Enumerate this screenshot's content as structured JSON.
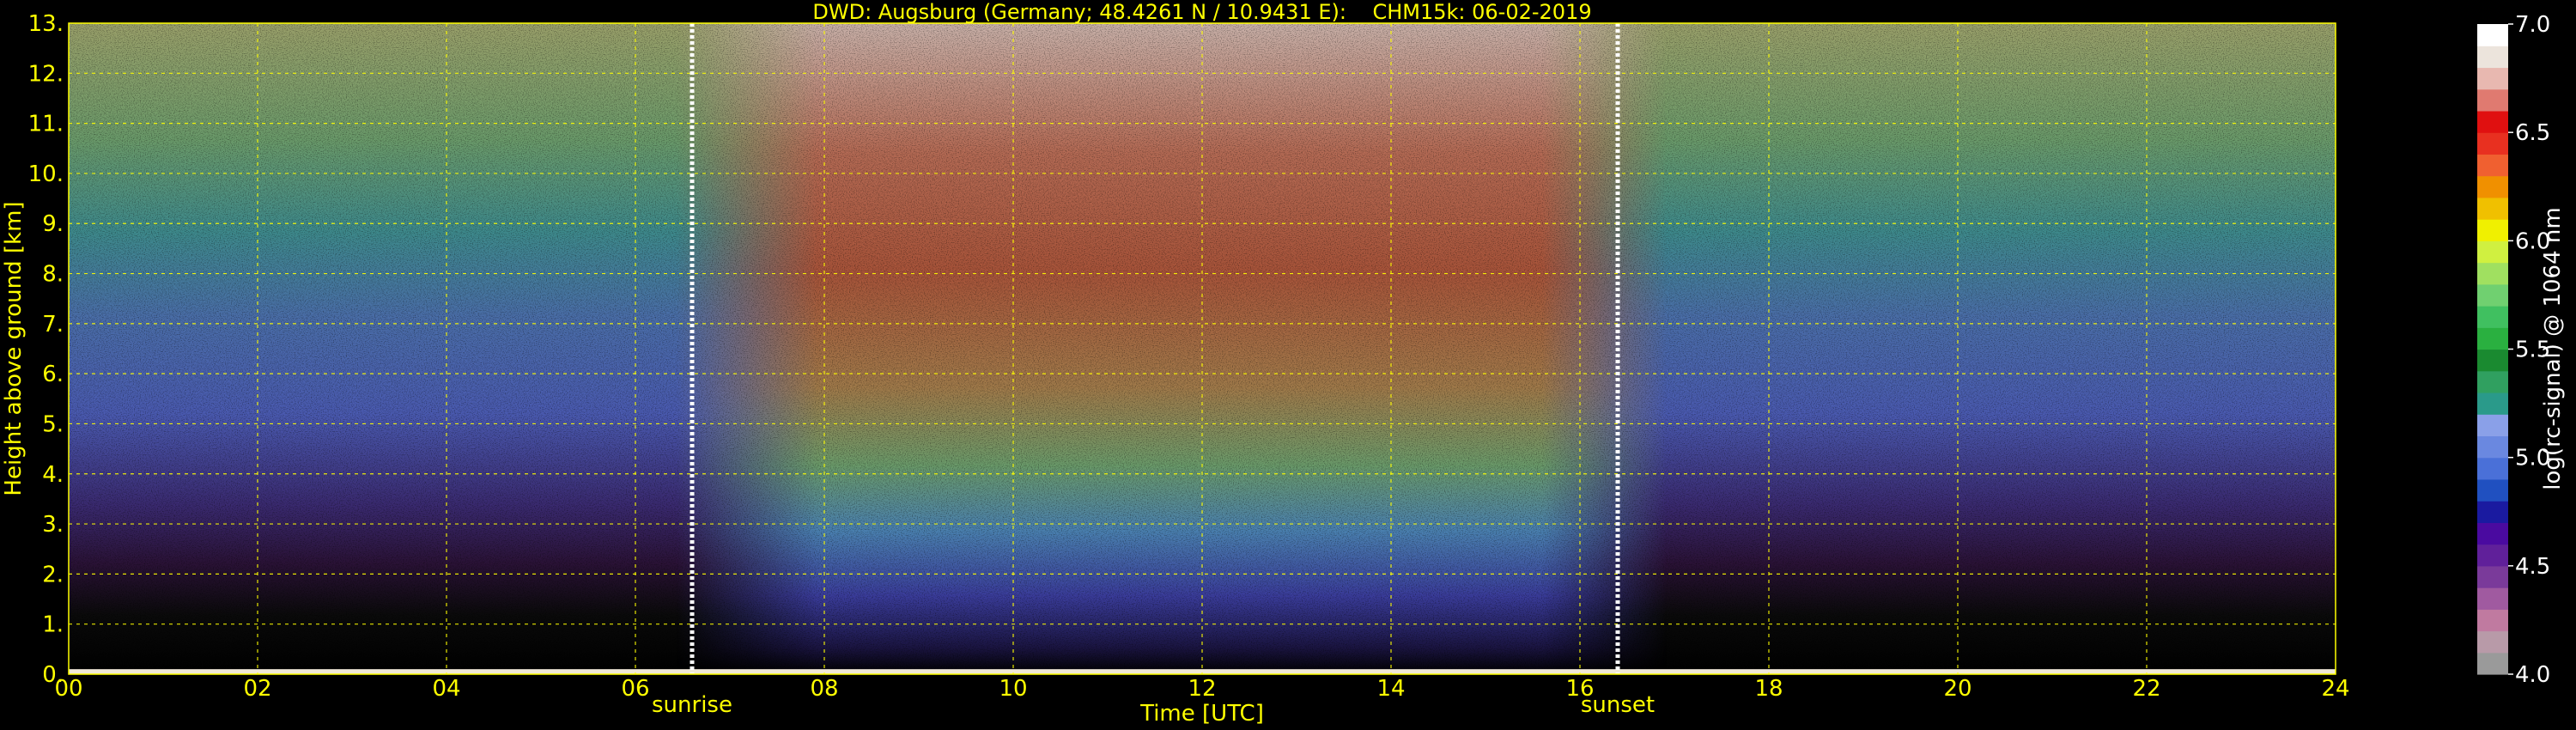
{
  "title": "DWD: Augsburg (Germany; 48.4261 N / 10.9431 E):    CHM15k: 06-02-2019",
  "colors": {
    "background": "#000000",
    "axis_text": "#ffff00",
    "grid": "#ffff00",
    "colorbar_text": "#ffffff",
    "marker_lines": "#ffffff"
  },
  "chart_data": {
    "type": "heatmap",
    "xlabel": "Time [UTC]",
    "ylabel": "Height above ground [km]",
    "xlim": [
      0,
      24
    ],
    "ylim": [
      0,
      13
    ],
    "x_ticks": [
      "00",
      "02",
      "04",
      "06",
      "08",
      "10",
      "12",
      "14",
      "16",
      "18",
      "20",
      "22",
      "24"
    ],
    "y_ticks": [
      "0.",
      "1.",
      "2.",
      "3.",
      "4.",
      "5.",
      "6.",
      "7.",
      "8.",
      "9.",
      "10.",
      "11.",
      "12.",
      "13."
    ],
    "grid": true,
    "annotations": [
      {
        "label": "sunrise",
        "x": 6.6
      },
      {
        "label": "sunset",
        "x": 16.4
      }
    ],
    "colorbar": {
      "label": "log(rc-signal) @ 1064 nm",
      "range": [
        4.0,
        7.0
      ],
      "ticks": [
        "4.0",
        "4.5",
        "5.0",
        "5.5",
        "6.0",
        "6.5",
        "7.0"
      ],
      "colors": [
        "#9a9a9a",
        "#b89aa8",
        "#c07aa0",
        "#a05aa0",
        "#7a3a9a",
        "#60209a",
        "#4a0aa0",
        "#1a1aa0",
        "#2050c0",
        "#4a70d8",
        "#6a88e0",
        "#8aa0e8",
        "#2a9a8a",
        "#30a060",
        "#1a8a30",
        "#2ab040",
        "#40c060",
        "#70d070",
        "#a0e060",
        "#d0f040",
        "#f0f000",
        "#f0c000",
        "#f09000",
        "#f06030",
        "#e83020",
        "#e01010",
        "#e07a70",
        "#e8b8b0",
        "#ece4dc",
        "#ffffff"
      ]
    },
    "surface_signal_km": 0.1
  }
}
